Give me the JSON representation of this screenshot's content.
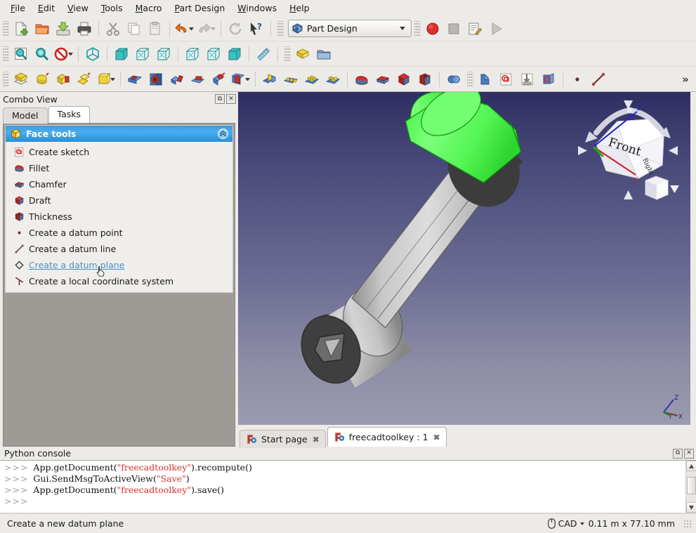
{
  "menubar": {
    "items": [
      {
        "label": "File",
        "mnemonic": "F"
      },
      {
        "label": "Edit",
        "mnemonic": "E"
      },
      {
        "label": "View",
        "mnemonic": "V"
      },
      {
        "label": "Tools",
        "mnemonic": "T"
      },
      {
        "label": "Macro",
        "mnemonic": "M"
      },
      {
        "label": "Part Design",
        "mnemonic": "P"
      },
      {
        "label": "Windows",
        "mnemonic": "W"
      },
      {
        "label": "Help",
        "mnemonic": "H"
      }
    ]
  },
  "toolbars": {
    "file_row": {
      "buttons": [
        {
          "name": "new-document-icon",
          "title": "New"
        },
        {
          "name": "open-document-icon",
          "title": "Open"
        },
        {
          "name": "save-document-icon",
          "title": "Save"
        },
        {
          "name": "print-document-icon",
          "title": "Print"
        },
        {
          "name": "cut-icon",
          "title": "Cut"
        },
        {
          "name": "copy-icon",
          "title": "Copy"
        },
        {
          "name": "paste-icon",
          "title": "Paste"
        },
        {
          "name": "undo-icon",
          "title": "Undo"
        },
        {
          "name": "redo-icon",
          "title": "Redo"
        },
        {
          "name": "refresh-icon",
          "title": "Refresh"
        },
        {
          "name": "whats-this-icon",
          "title": "What's This"
        }
      ],
      "workbench_label": "Part Design",
      "macro_buttons": [
        {
          "name": "macro-record-icon",
          "title": "Macro recording"
        },
        {
          "name": "macro-stop-icon",
          "title": "Stop macro recording"
        },
        {
          "name": "macro-edit-icon",
          "title": "Macros"
        },
        {
          "name": "macro-execute-icon",
          "title": "Execute macro"
        }
      ]
    },
    "view_row": {
      "buttons": [
        {
          "name": "fit-all-icon",
          "title": "Fit all"
        },
        {
          "name": "fit-selection-icon",
          "title": "Fit selection"
        },
        {
          "name": "draw-style-icon",
          "title": "Draw style"
        },
        {
          "name": "isometric-view-icon",
          "title": "Axonometric"
        },
        {
          "name": "front-view-icon",
          "title": "Front"
        },
        {
          "name": "top-view-icon",
          "title": "Top"
        },
        {
          "name": "right-view-icon",
          "title": "Right"
        },
        {
          "name": "rear-view-icon",
          "title": "Rear"
        },
        {
          "name": "bottom-view-icon",
          "title": "Bottom"
        },
        {
          "name": "left-view-icon",
          "title": "Left"
        },
        {
          "name": "measure-icon",
          "title": "Measure"
        },
        {
          "name": "create-part-icon",
          "title": "Create part"
        },
        {
          "name": "create-group-icon",
          "title": "Create group"
        }
      ]
    },
    "partdesign_row": {
      "buttons": [
        {
          "name": "create-body-icon",
          "title": "Create body"
        },
        {
          "name": "pad-icon",
          "title": "Pad"
        },
        {
          "name": "revolution-icon",
          "title": "Revolution"
        },
        {
          "name": "additive-loft-icon",
          "title": "Additive loft"
        },
        {
          "name": "additive-pipe-icon",
          "title": "Additive pipe"
        },
        {
          "name": "pocket-icon",
          "title": "Pocket"
        },
        {
          "name": "hole-icon",
          "title": "Hole"
        },
        {
          "name": "groove-icon",
          "title": "Groove"
        },
        {
          "name": "subtractive-loft-icon",
          "title": "Subtractive loft"
        },
        {
          "name": "subtractive-pipe-icon",
          "title": "Subtractive pipe"
        },
        {
          "name": "subtractive-primitive-icon",
          "title": "Subtractive primitive"
        },
        {
          "name": "mirrored-icon",
          "title": "Mirrored"
        },
        {
          "name": "linear-pattern-icon",
          "title": "Linear pattern"
        },
        {
          "name": "polar-pattern-icon",
          "title": "Polar pattern"
        },
        {
          "name": "multi-transform-icon",
          "title": "Multi transform"
        },
        {
          "name": "fillet-icon",
          "title": "Fillet"
        },
        {
          "name": "chamfer-icon",
          "title": "Chamfer"
        },
        {
          "name": "draft-icon",
          "title": "Draft"
        },
        {
          "name": "thickness-icon",
          "title": "Thickness"
        },
        {
          "name": "boolean-icon",
          "title": "Boolean"
        },
        {
          "name": "shape-binder-icon",
          "title": "Shape binder"
        },
        {
          "name": "create-sketch-icon",
          "title": "Create sketch"
        },
        {
          "name": "attach-sketch-icon",
          "title": "Attach sketch"
        },
        {
          "name": "validate-sketch-icon",
          "title": "Validate sketch"
        },
        {
          "name": "datum-point-icon",
          "title": "Create datum point"
        },
        {
          "name": "datum-line-icon",
          "title": "Create datum line"
        }
      ],
      "overflow_label": "»"
    }
  },
  "combo_view": {
    "title": "Combo View",
    "float_button": "⧉",
    "close_button": "✕",
    "tabs": [
      {
        "label": "Model",
        "active": false
      },
      {
        "label": "Tasks",
        "active": true
      }
    ],
    "group": {
      "title": "Face tools",
      "collapse_icon": "⌃⌃",
      "items": [
        {
          "label": "Create sketch",
          "icon": "create-sketch-icon",
          "hovered": false
        },
        {
          "label": "Fillet",
          "icon": "fillet-icon",
          "hovered": false
        },
        {
          "label": "Chamfer",
          "icon": "chamfer-icon",
          "hovered": false
        },
        {
          "label": "Draft",
          "icon": "draft-icon",
          "hovered": false
        },
        {
          "label": "Thickness",
          "icon": "thickness-icon",
          "hovered": false
        },
        {
          "label": "Create a datum point",
          "icon": "datum-point-icon",
          "hovered": false
        },
        {
          "label": "Create a datum line",
          "icon": "datum-line-icon",
          "hovered": false
        },
        {
          "label": "Create a datum plane",
          "icon": "datum-plane-icon",
          "hovered": true
        },
        {
          "label": "Create a local coordinate system",
          "icon": "local-coordinate-system-icon",
          "hovered": false
        }
      ]
    }
  },
  "view3d": {
    "navigation_cube": {
      "front_face_label": "Front",
      "right_face_label": "Right",
      "z_axis_label": "Z",
      "x_axis_label": "X",
      "home_button": "home-cube-icon",
      "menu_caret": "▼"
    },
    "axis_indicator": {
      "z_label": "Z",
      "x_label": "X",
      "y_label": "Y"
    },
    "model": {
      "name": "socket-head-screw",
      "highlight_color": "#5cf25c",
      "body_color": "#bcbcbc",
      "shadow_color": "#4a4a4a"
    },
    "background": {
      "top_color": "#2e2e63",
      "bottom_color": "#9a9ab0"
    },
    "tabs": [
      {
        "label": "Start page",
        "active": false,
        "close": "✖"
      },
      {
        "label": "freecadtoolkey : 1",
        "active": true,
        "close": "✖"
      }
    ]
  },
  "python_console": {
    "title": "Python console",
    "float_button": "⧉",
    "close_button": "✕",
    "lines": [
      {
        "prompt": ">>>",
        "parts": [
          {
            "t": "App.getDocument(",
            "k": "plain"
          },
          {
            "t": "\"freecadtoolkey\"",
            "k": "string"
          },
          {
            "t": ").recompute()",
            "k": "plain"
          }
        ]
      },
      {
        "prompt": ">>>",
        "parts": [
          {
            "t": "Gui.SendMsgToActiveView(",
            "k": "plain"
          },
          {
            "t": "\"Save\"",
            "k": "string"
          },
          {
            "t": ")",
            "k": "plain"
          }
        ]
      },
      {
        "prompt": ">>>",
        "parts": [
          {
            "t": "App.getDocument(",
            "k": "plain"
          },
          {
            "t": "\"freecadtoolkey\"",
            "k": "string"
          },
          {
            "t": ").save()",
            "k": "plain"
          }
        ]
      },
      {
        "prompt": ">>>",
        "parts": []
      }
    ],
    "scrollbar": {
      "up": "▲",
      "down": "▼"
    }
  },
  "statusbar": {
    "message": "Create a new datum plane",
    "unit_icon": "mouse-icon",
    "unit_label": "CAD",
    "unit_caret": "▾",
    "dimensions": "0.11 m x 77.10 mm"
  }
}
